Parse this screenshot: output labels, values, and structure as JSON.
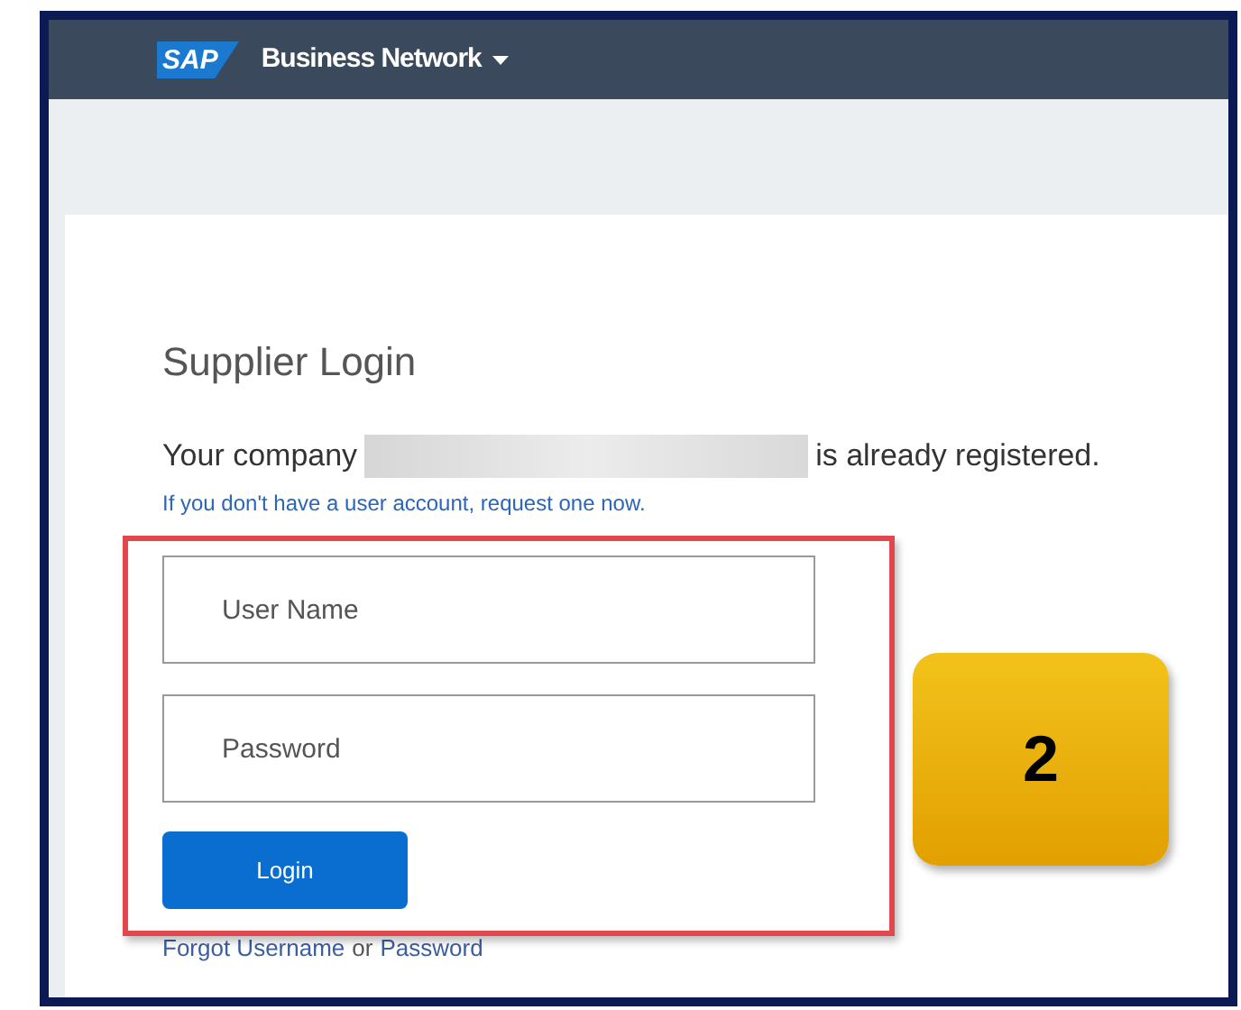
{
  "header": {
    "logo": "SAP",
    "title": "Business Network"
  },
  "login": {
    "title": "Supplier Login",
    "company_prefix": "Your company",
    "company_suffix": "is already registered.",
    "request_link": "If you don't have a user account, request one now.",
    "fields": [
      {
        "placeholder": "User Name"
      },
      {
        "placeholder": "Password"
      }
    ],
    "button": "Login",
    "forgot_username": "Forgot Username",
    "or": "or",
    "forgot_password": "Password"
  },
  "callout": {
    "number": "2"
  }
}
